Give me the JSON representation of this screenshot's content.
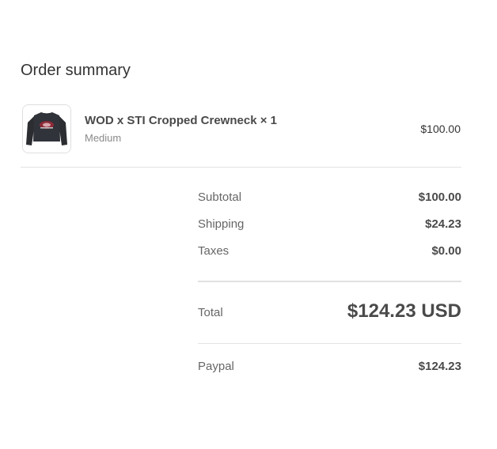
{
  "summary": {
    "heading": "Order summary"
  },
  "product": {
    "title": "WOD x STI Cropped Crewneck",
    "quantity": "× 1",
    "variant": "Medium",
    "price": "$100.00",
    "image_icon": "cropped-crewneck-sweatshirt-image"
  },
  "totals": {
    "subtotal_label": "Subtotal",
    "subtotal_value": "$100.00",
    "shipping_label": "Shipping",
    "shipping_value": "$24.23",
    "taxes_label": "Taxes",
    "taxes_value": "$0.00",
    "total_label": "Total",
    "total_value": "$124.23 USD"
  },
  "payment": {
    "method_label": "Paypal",
    "amount": "$124.23"
  },
  "colors": {
    "text": "#333333",
    "muted": "#666666",
    "divider": "#e3e3e3"
  }
}
